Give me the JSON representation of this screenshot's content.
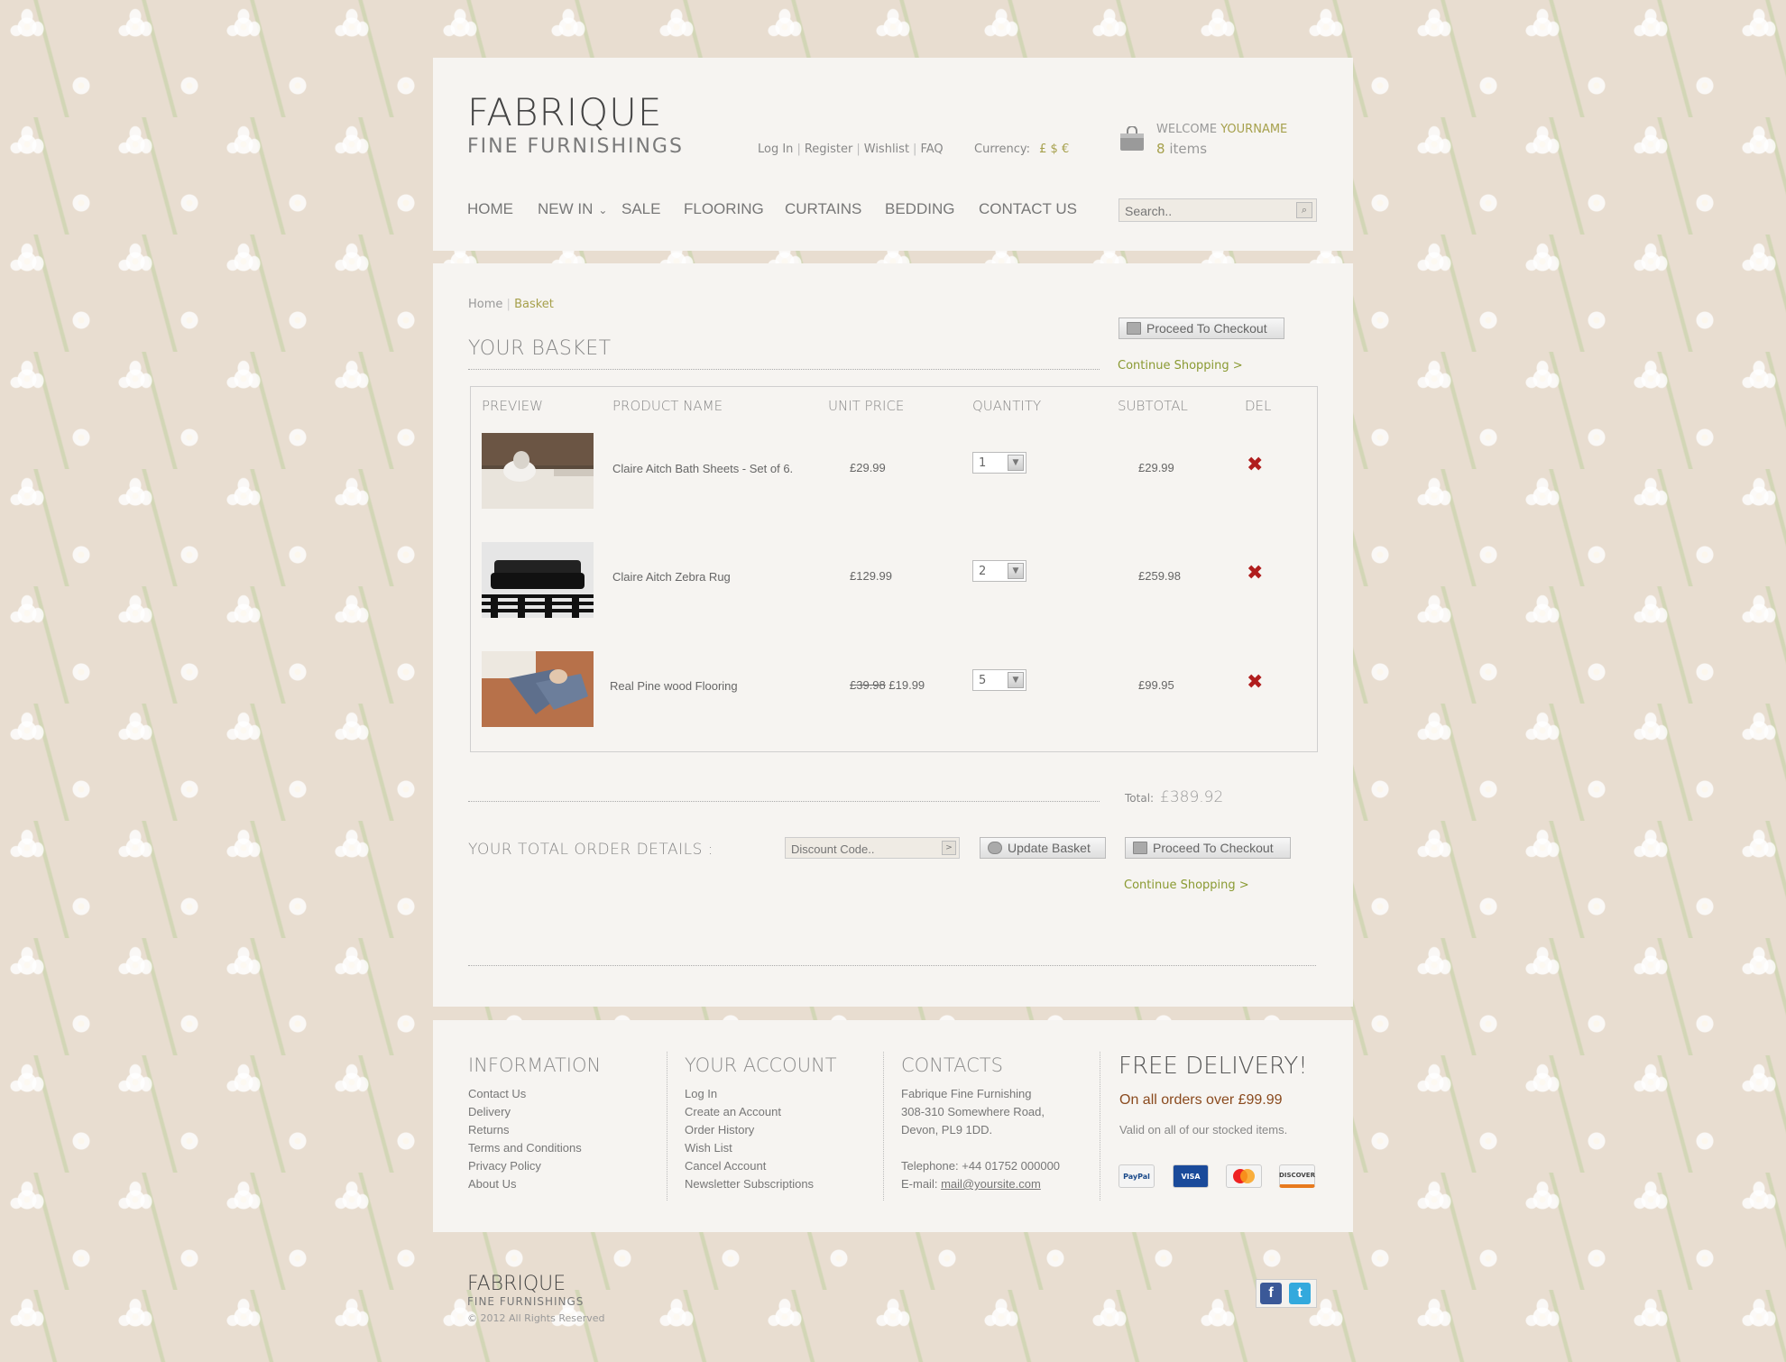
{
  "brand": {
    "name": "FABRIQUE",
    "tagline": "FINE FURNISHINGS"
  },
  "top_links": [
    "Log In",
    "Register",
    "Wishlist",
    "FAQ"
  ],
  "currency": {
    "label": "Currency:",
    "options": "£ $ €"
  },
  "account": {
    "welcome": "WELCOME",
    "username": "YOURNAME",
    "item_count": "8",
    "items_label": "items"
  },
  "nav": [
    "HOME",
    "NEW IN",
    "SALE",
    "FLOORING",
    "CURTAINS",
    "BEDDING",
    "CONTACT US"
  ],
  "search": {
    "placeholder": "Search.."
  },
  "breadcrumb": {
    "home": "Home",
    "current": "Basket"
  },
  "basket": {
    "title": "YOUR BASKET",
    "checkout_label": "Proceed To Checkout",
    "continue_label": "Continue Shopping >",
    "columns": [
      "PREVIEW",
      "PRODUCT NAME",
      "UNIT PRICE",
      "QUANTITY",
      "SUBTOTAL",
      "DEL"
    ],
    "rows": [
      {
        "name": "Claire Aitch Bath Sheets - Set of 6.",
        "old_price": "",
        "price": "£29.99",
        "qty": "1",
        "subtotal": "£29.99",
        "image": "towels-on-bed"
      },
      {
        "name": "Claire Aitch Zebra Rug",
        "old_price": "",
        "price": "£129.99",
        "qty": "2",
        "subtotal": "£259.98",
        "image": "black-sofa-zebra-rug"
      },
      {
        "name": "Real Pine wood Flooring",
        "old_price": "£39.98",
        "price": "£19.99",
        "qty": "5",
        "subtotal": "£99.95",
        "image": "couple-on-wood-floor"
      }
    ],
    "total_label": "Total:",
    "total_value": "£389.92"
  },
  "order": {
    "title": "YOUR TOTAL ORDER DETAILS :",
    "discount_placeholder": "Discount Code..",
    "update_label": "Update Basket",
    "checkout_label": "Proceed To Checkout",
    "continue_label": "Continue Shopping >"
  },
  "footer": {
    "information": {
      "title": "INFORMATION",
      "items": [
        "Contact Us",
        "Delivery",
        "Returns",
        "Terms and Conditions",
        "Privacy Policy",
        "About Us"
      ]
    },
    "account": {
      "title": "YOUR ACCOUNT",
      "items": [
        "Log In",
        "Create an Account",
        "Order History",
        "Wish List",
        "Cancel Account",
        "Newsletter Subscriptions"
      ]
    },
    "contacts": {
      "title": "CONTACTS",
      "company": "Fabrique Fine Furnishing",
      "address1": "308-310 Somewhere Road,",
      "address2": "Devon,  PL9 1DD.",
      "phone": "Telephone: +44 01752 000000",
      "email_label": "E-mail:",
      "email": "mail@yoursite.com"
    },
    "delivery": {
      "title": "FREE DELIVERY!",
      "subtitle": "On all orders over £99.99",
      "note": "Valid on all of our stocked items."
    },
    "cards": [
      "PayPal",
      "VISA",
      "MasterCard",
      "DISCOVER"
    ]
  },
  "bottom": {
    "brand": "FABRIQUE",
    "tagline": "FINE FURNISHINGS",
    "copyright": "© 2012 All Rights Reserved"
  },
  "social": [
    "facebook",
    "twitter"
  ],
  "colors": {
    "accent_green": "#a6a04c",
    "delete_red": "#b01d1d",
    "panel": "#f6f4f1",
    "background": "#e8ddd0"
  }
}
